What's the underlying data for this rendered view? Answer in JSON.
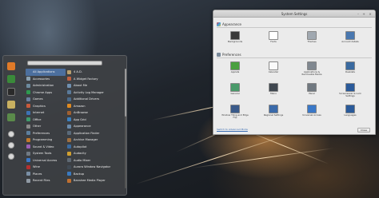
{
  "menu": {
    "search": {
      "placeholder": ""
    },
    "categories": [
      {
        "label": "All Applications",
        "color": "#4c6f9e",
        "selected": true
      },
      {
        "label": "Accessories",
        "color": "#8aa1b1"
      },
      {
        "label": "Administration",
        "color": "#6c8a9e"
      },
      {
        "label": "Chrome Apps",
        "color": "#2e9a4f"
      },
      {
        "label": "Games",
        "color": "#6a7fa0"
      },
      {
        "label": "Graphics",
        "color": "#c85a3b"
      },
      {
        "label": "Internet",
        "color": "#3d72b5"
      },
      {
        "label": "Office",
        "color": "#3f9a6b"
      },
      {
        "label": "Other",
        "color": "#8a8a8a"
      },
      {
        "label": "Preferences",
        "color": "#5d7f9e"
      },
      {
        "label": "Programming",
        "color": "#c0782a"
      },
      {
        "label": "Sound & Video",
        "color": "#9a5fb5"
      },
      {
        "label": "System Tools",
        "color": "#707a84"
      },
      {
        "label": "Universal Access",
        "color": "#3a78c8"
      },
      {
        "label": "Wine",
        "color": "#b53030"
      },
      {
        "label": "Places",
        "color": "#7a8fa5"
      },
      {
        "label": "Recent Files",
        "color": "#909aa4"
      }
    ],
    "apps": [
      {
        "label": "4 A.D.",
        "color": "#b8a070"
      },
      {
        "label": "A Widget Factory",
        "color": "#c06040"
      },
      {
        "label": "About Me",
        "color": "#7090b0"
      },
      {
        "label": "Activity Log Manager",
        "color": "#5a7a9a"
      },
      {
        "label": "Additional Drivers",
        "color": "#4a6a8a"
      },
      {
        "label": "Amazon",
        "color": "#e08a20"
      },
      {
        "label": "AnBrowse",
        "color": "#a06030"
      },
      {
        "label": "App Grid",
        "color": "#3a80c0"
      },
      {
        "label": "Appearance",
        "color": "#6a8aaa"
      },
      {
        "label": "Application Finder",
        "color": "#5a6a7a"
      },
      {
        "label": "Archive Manager",
        "color": "#a07040"
      },
      {
        "label": "Autopilot",
        "color": "#3a6aa0"
      },
      {
        "label": "Audacity",
        "color": "#d0a030"
      },
      {
        "label": "Audio Mixer",
        "color": "#606a74"
      },
      {
        "label": "Aurora Window Navigator",
        "color": "#404a54"
      },
      {
        "label": "Backup",
        "color": "#3a7ac0"
      },
      {
        "label": "Banshee Media Player",
        "color": "#c07030"
      }
    ],
    "favorites": [
      {
        "name": "firefox-icon",
        "color": "#e07a28"
      },
      {
        "name": "synaptic-icon",
        "color": "#3a8a3a"
      },
      {
        "name": "terminal-icon",
        "color": "#2a2a2a"
      },
      {
        "name": "folder-icon",
        "color": "#c8b060"
      },
      {
        "name": "settings-icon",
        "color": "#5a8a4a"
      }
    ]
  },
  "window": {
    "title": "System Settings",
    "appearance_label": "Appearance",
    "preferences_label": "Preferences",
    "appearance_items": [
      {
        "label": "Backgrounds",
        "color": "#3a3a3a"
      },
      {
        "label": "Fonts",
        "color": "#ffffff"
      },
      {
        "label": "Themes",
        "color": "#a0a8b0"
      },
      {
        "label": "Account details",
        "color": "#4a78b0"
      }
    ],
    "preferences_items": [
      {
        "label": "Applets",
        "color": "#4aa040"
      },
      {
        "label": "Calendar",
        "color": "#fafafa"
      },
      {
        "label": "Applications & Removable Media",
        "color": "#808890"
      },
      {
        "label": "Desklets",
        "color": "#3a6aa0"
      },
      {
        "label": "General",
        "color": "#4a9a6a"
      },
      {
        "label": "Menu",
        "color": "#404850"
      },
      {
        "label": "Panel",
        "color": "#707880"
      },
      {
        "label": "Screensaver & Lock Settings",
        "color": "#2a5a9a"
      },
      {
        "label": "Window Tiling and Edge Flip",
        "color": "#3a5a8a"
      },
      {
        "label": "Regional Settings",
        "color": "#3a6aaa"
      },
      {
        "label": "Universal Access",
        "color": "#3a78c8"
      },
      {
        "label": "Languages",
        "color": "#2a5a9a"
      }
    ],
    "advanced_link": "Switch to Advanced Mode",
    "close_label": "Close",
    "min_glyph": "–",
    "max_glyph": "+",
    "close_glyph": "×"
  }
}
